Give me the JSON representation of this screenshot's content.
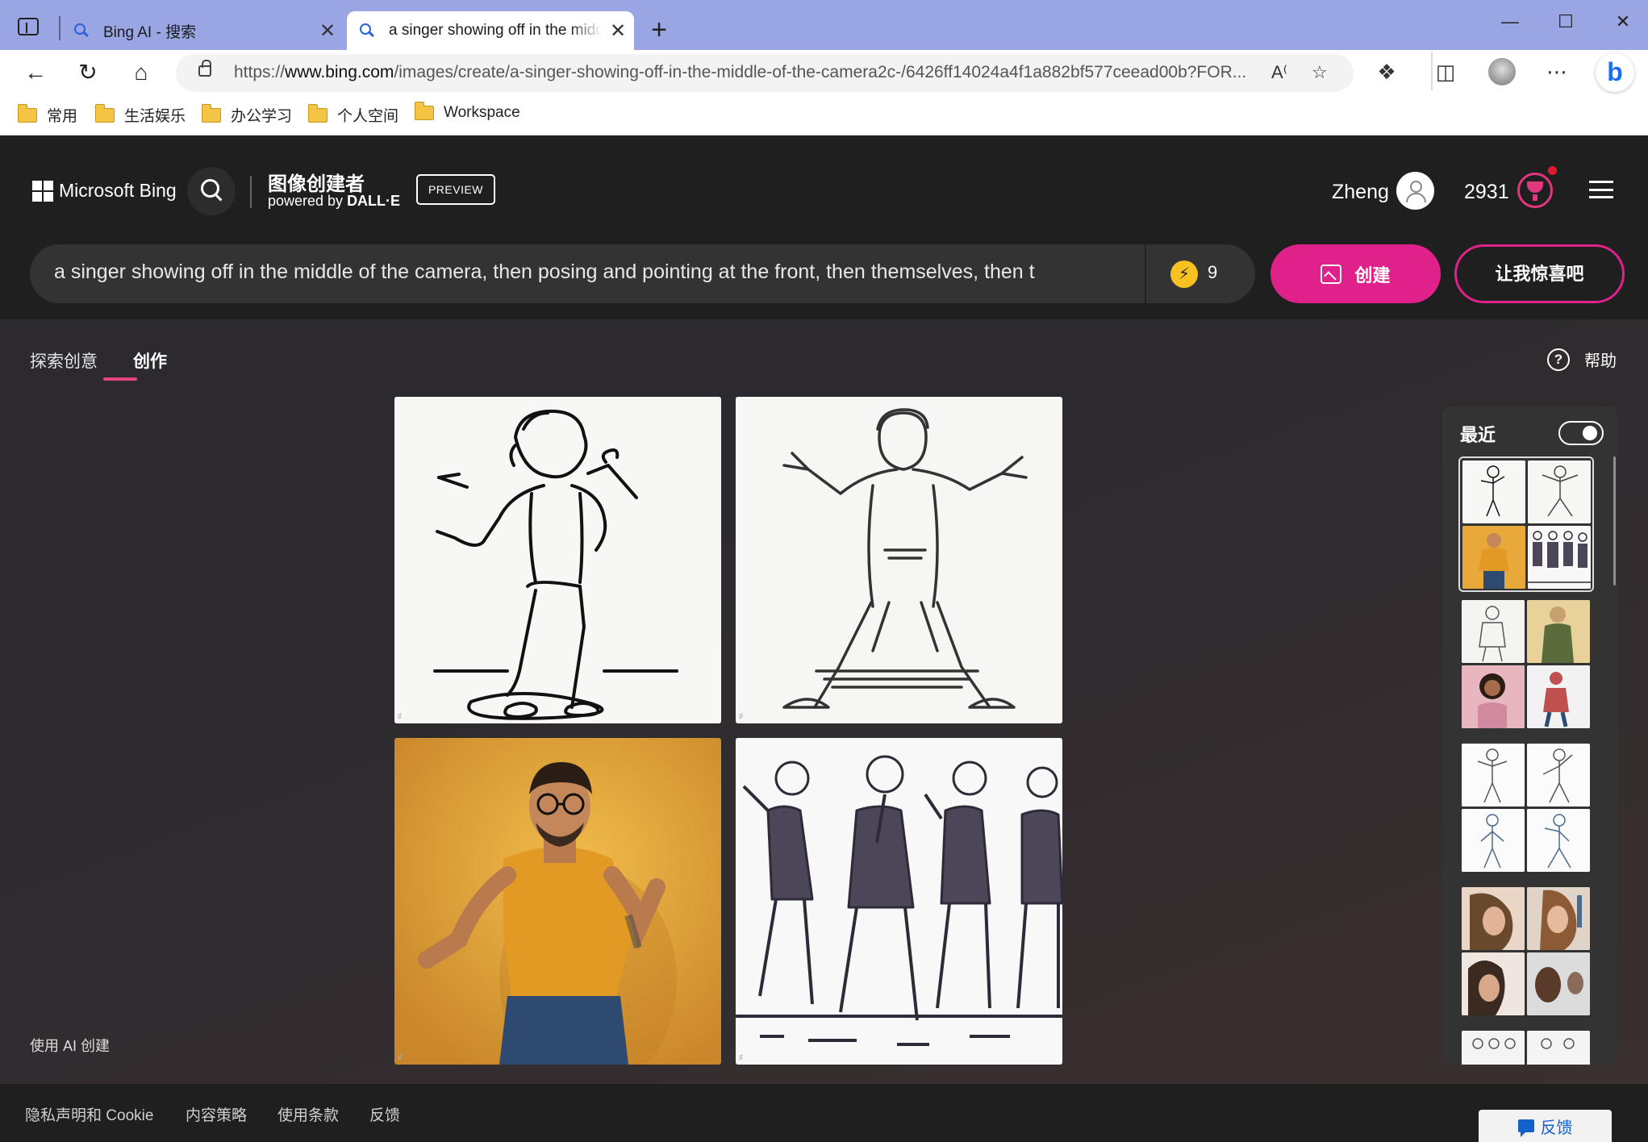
{
  "browser": {
    "tabs": [
      {
        "title": "Bing AI - 搜索",
        "active": false,
        "icon": "search-icon"
      },
      {
        "title": "a singer showing off in the middl",
        "active": true,
        "icon": "search-icon"
      }
    ],
    "new_tab_glyph": "+",
    "close_glyph": "✕",
    "window_controls": {
      "minimize": "—",
      "maximize": "☐",
      "close": "✕"
    },
    "url_prefix": "https://",
    "url_host": "www.bing.com",
    "url_path": "/images/create/a-singer-showing-off-in-the-middle-of-the-camera2c-/6426ff14024a4f1a882bf577ceead00b?FOR...",
    "bookmarks": [
      "常用",
      "生活娱乐",
      "办公学习",
      "个人空间",
      "Workspace"
    ]
  },
  "header": {
    "brand": "Microsoft Bing",
    "title": "图像创建者",
    "powered_by": "powered by ",
    "powered_by_brand": "DALL·E",
    "preview_label": "PREVIEW",
    "user_name": "Zheng",
    "points": "2931"
  },
  "prompt": {
    "text": "a singer showing off in the middle of the camera, then posing and pointing at the front, then themselves, then t",
    "boosts": "9",
    "create_label": "创建",
    "surprise_label": "让我惊喜吧"
  },
  "tabs": {
    "explore": "探索创意",
    "create": "创作",
    "help": "帮助"
  },
  "images": [
    {
      "style": "line-art",
      "description_icon": "singer-sketch-1"
    },
    {
      "style": "line-art",
      "description_icon": "singer-sketch-2"
    },
    {
      "style": "photo",
      "description_icon": "singer-photo"
    },
    {
      "style": "line-art",
      "description_icon": "group-sketch"
    }
  ],
  "made_with_ai": "使用 AI 创建",
  "recent": {
    "title": "最近",
    "toggle_on": true
  },
  "footer": {
    "links": [
      "隐私声明和 Cookie",
      "内容策略",
      "使用条款",
      "反馈"
    ],
    "feedback_button": "反馈"
  },
  "colors": {
    "accent": "#e1218b",
    "boost": "#f6c121",
    "tabbar": "#99a6e3"
  }
}
